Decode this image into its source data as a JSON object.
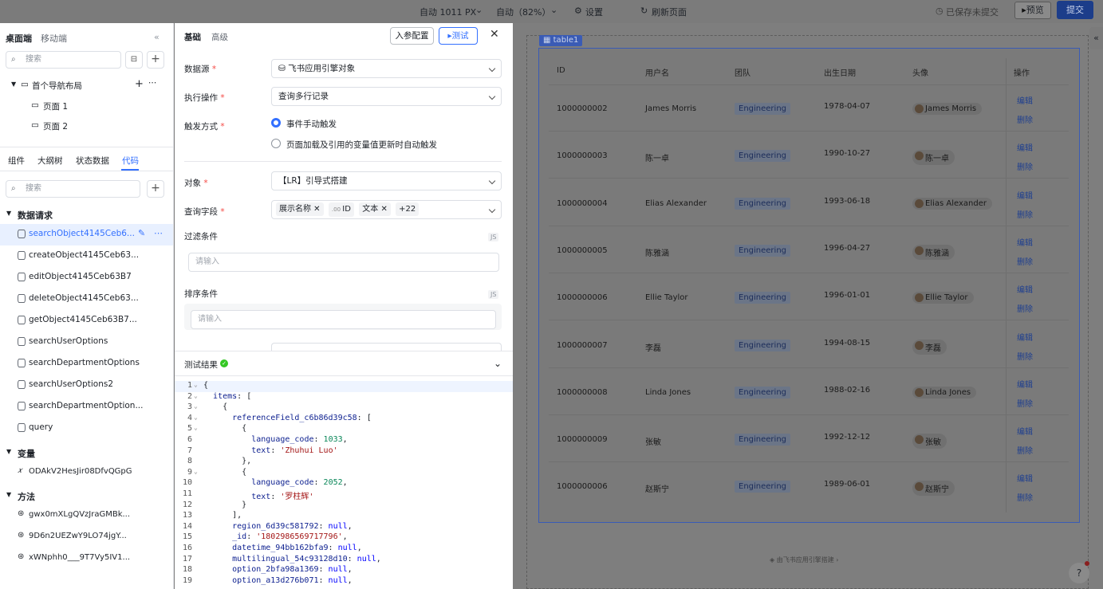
{
  "topbar": {
    "width_select": "自动 1011 PX",
    "zoom_select": "自动（82%）",
    "settings": "设置",
    "refresh": "刷新页面",
    "save_status": "已保存未提交",
    "preview": "预览",
    "submit": "提交"
  },
  "left": {
    "tab_desktop": "桌面端",
    "tab_mobile": "移动端",
    "search_placeholder": "搜索",
    "nav_layout": "首个导航布局",
    "pages": [
      "页面 1",
      "页面 2"
    ],
    "tabs": [
      "组件",
      "大纲树",
      "状态数据",
      "代码"
    ],
    "code_search_placeholder": "搜索",
    "section_requests": "数据请求",
    "requests": [
      "searchObject4145Ceb6...",
      "createObject4145Ceb63...",
      "editObject4145Ceb63B7",
      "deleteObject4145Ceb63...",
      "getObject4145Ceb63B7...",
      "searchUserOptions",
      "searchDepartmentOptions",
      "searchUserOptions2",
      "searchDepartmentOption...",
      "query"
    ],
    "section_vars": "变量",
    "vars": [
      "ODAkV2HesJir08DfvQGpG"
    ],
    "section_methods": "方法",
    "methods": [
      "gwx0mXLgQVzJraGMBk...",
      "9D6n2UEZwY9LO74jgY...",
      "xWNphh0___9T7Vy5IV1..."
    ]
  },
  "mid": {
    "tab_basic": "基础",
    "tab_advanced": "高级",
    "param_config": "入参配置",
    "test": "测试",
    "datasource_label": "数据源",
    "datasource_value": "飞书应用引擎对象",
    "action_label": "执行操作",
    "action_value": "查询多行记录",
    "trigger_label": "触发方式",
    "trigger_manual": "事件手动触发",
    "trigger_auto": "页面加载及引用的变量值更新时自动触发",
    "object_label": "对象",
    "object_value": "【LR】引导式搭建",
    "fields_label": "查询字段",
    "field_tags": [
      "展示名称",
      "ID",
      "文本",
      "+22"
    ],
    "filter_label": "过滤条件",
    "filter_placeholder": "请输入",
    "sort_label": "排序条件",
    "sort_placeholder": "请输入",
    "js_badge": "JS",
    "result_label": "测试结果"
  },
  "code_lines": [
    "{",
    "  items: [",
    "    {",
    "      referenceField_c6b86d39c58: [",
    "        {",
    "          language_code: 1033,",
    "          text: 'Zhuhui Luo'",
    "        },",
    "        {",
    "          language_code: 2052,",
    "          text: '罗柱辉'",
    "        }",
    "      ],",
    "      region_6d39c581792: null,",
    "      _id: '1802986569717796',",
    "      datetime_94bb162bfa9: null,",
    "      multilingual_54c93128d10: null,",
    "      option_2bfa98a1369: null,",
    "      option_a13d276b071: null,"
  ],
  "canvas": {
    "table_label": "table1",
    "footer": "由飞书应用引擎搭建",
    "columns": [
      "ID",
      "用户名",
      "团队",
      "出生日期",
      "头像",
      "操作"
    ],
    "rows": [
      {
        "id": "1000000002",
        "name": "James Morris",
        "team": "Engineering",
        "dob": "1978-04-07",
        "avatar": "James Morris"
      },
      {
        "id": "1000000003",
        "name": "陈一卓",
        "team": "Engineering",
        "dob": "1990-10-27",
        "avatar": "陈一卓"
      },
      {
        "id": "1000000004",
        "name": "Elias Alexander",
        "team": "Engineering",
        "dob": "1993-06-18",
        "avatar": "Elias Alexander"
      },
      {
        "id": "1000000005",
        "name": "陈雅涵",
        "team": "Engineering",
        "dob": "1996-04-27",
        "avatar": "陈雅涵"
      },
      {
        "id": "1000000006",
        "name": "Ellie Taylor",
        "team": "Engineering",
        "dob": "1996-01-01",
        "avatar": "Ellie Taylor"
      },
      {
        "id": "1000000007",
        "name": "李磊",
        "team": "Engineering",
        "dob": "1994-08-15",
        "avatar": "李磊"
      },
      {
        "id": "1000000008",
        "name": "Linda Jones",
        "team": "Engineering",
        "dob": "1988-02-16",
        "avatar": "Linda Jones"
      },
      {
        "id": "1000000009",
        "name": "张敏",
        "team": "Engineering",
        "dob": "1992-12-12",
        "avatar": "张敏"
      },
      {
        "id": "1000000006",
        "name": "赵斯宁",
        "team": "Engineering",
        "dob": "1989-06-01",
        "avatar": "赵斯宁"
      }
    ],
    "edit": "编辑",
    "delete": "删除"
  }
}
